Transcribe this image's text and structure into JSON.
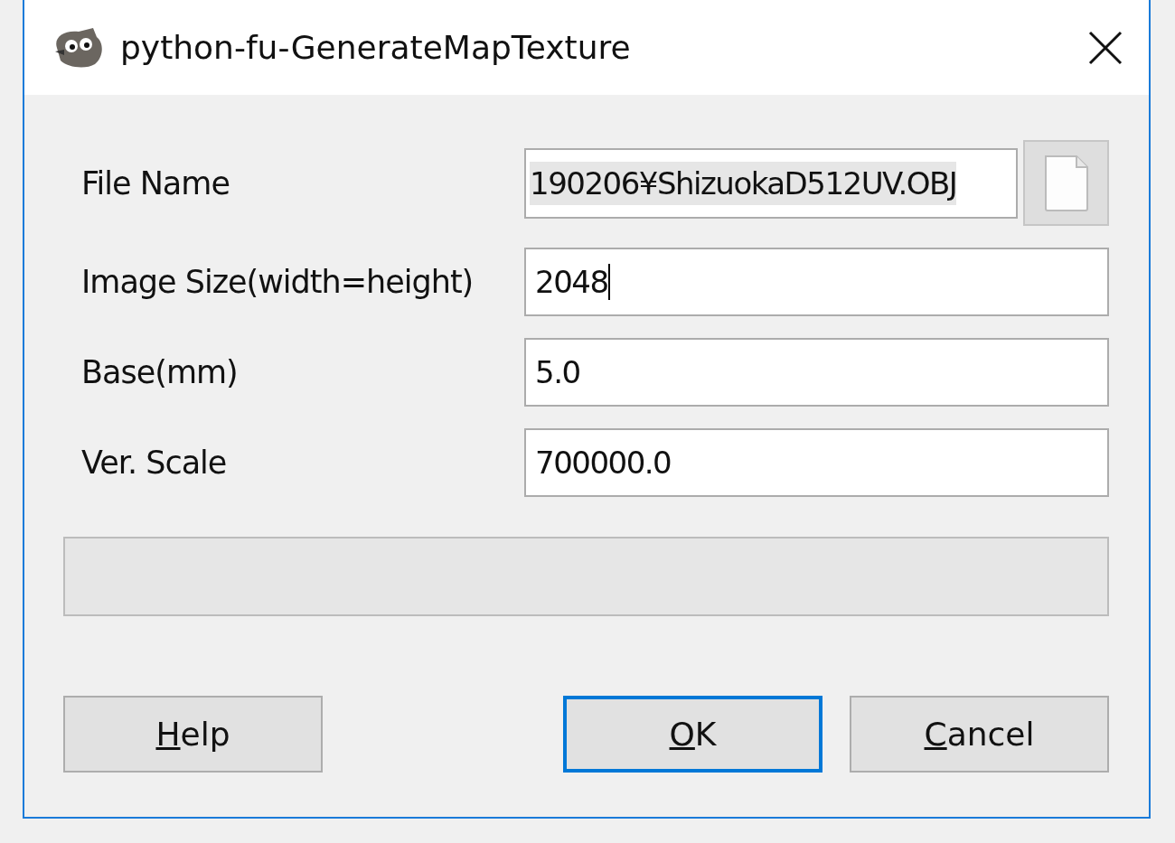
{
  "window": {
    "title": "python-fu-GenerateMapTexture"
  },
  "fields": [
    {
      "kind": "file",
      "label": "File Name",
      "value": "190206¥ShizuokaD512UV.OBJ",
      "text_selected": true,
      "focused": false
    },
    {
      "kind": "text",
      "label": "Image Size(width=height)",
      "value": "2048",
      "text_selected": false,
      "focused": true
    },
    {
      "kind": "text",
      "label": "Base(mm)",
      "value": "5.0",
      "text_selected": false,
      "focused": false
    },
    {
      "kind": "text",
      "label": "Ver. Scale",
      "value": "700000.0",
      "text_selected": false,
      "focused": false
    }
  ],
  "progress": {
    "level": 0
  },
  "buttons": [
    {
      "label": "Help",
      "default": false
    },
    {
      "label": "OK",
      "default": true
    },
    {
      "label": "Cancel",
      "default": false
    }
  ]
}
